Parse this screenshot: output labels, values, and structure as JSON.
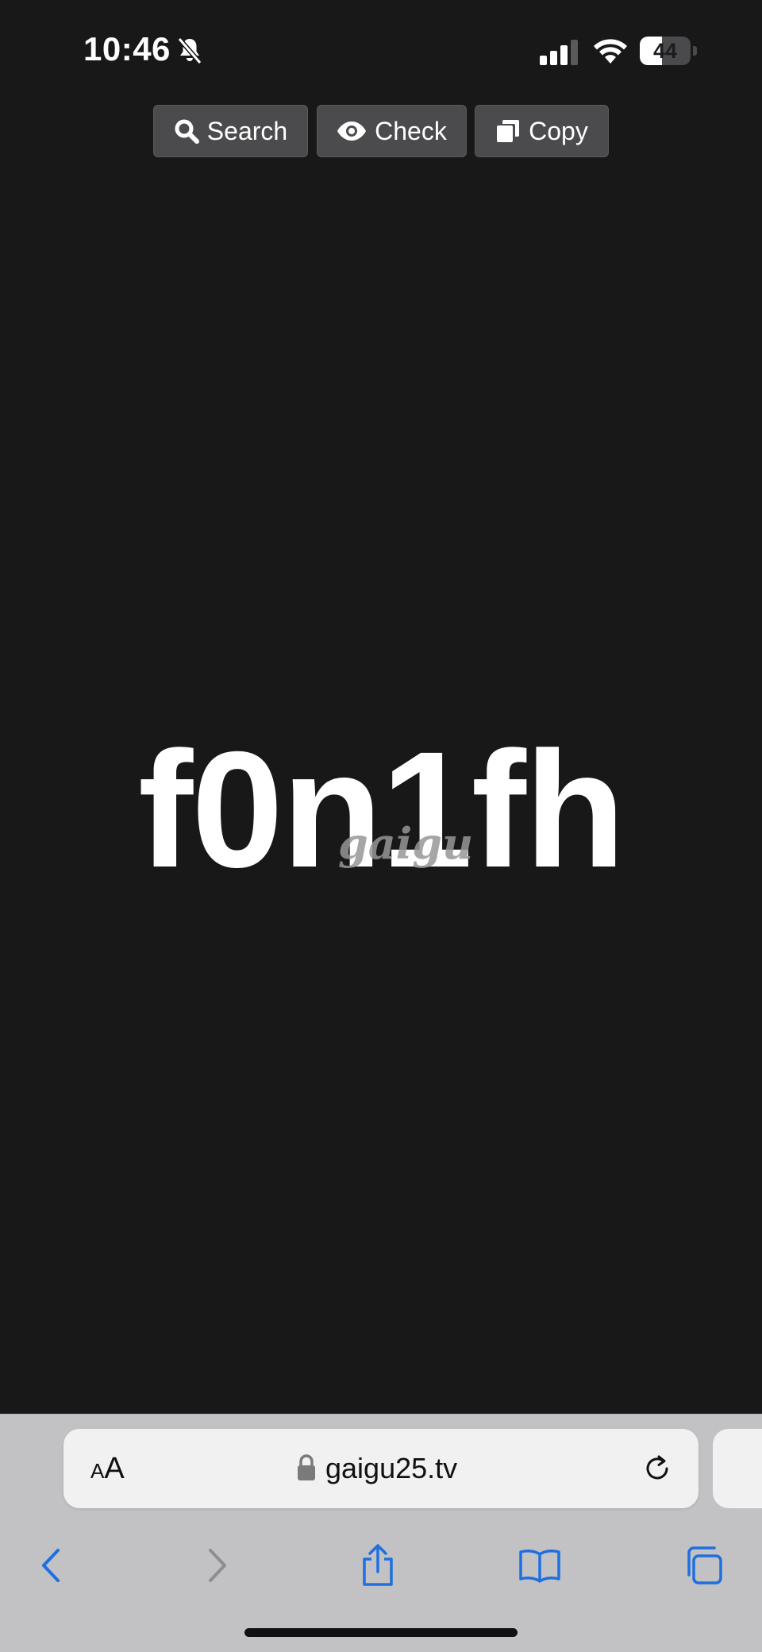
{
  "status_bar": {
    "time": "10:46",
    "battery_level": "44",
    "battery_fraction": 0.44
  },
  "toolbar": {
    "search_label": "Search",
    "check_label": "Check",
    "copy_label": "Copy"
  },
  "main": {
    "code": "f0n1fh",
    "watermark": "gaigu"
  },
  "browser": {
    "text_size_small": "A",
    "text_size_large": "A",
    "url": "gaigu25.tv",
    "accent_color": "#1e6fe0"
  }
}
